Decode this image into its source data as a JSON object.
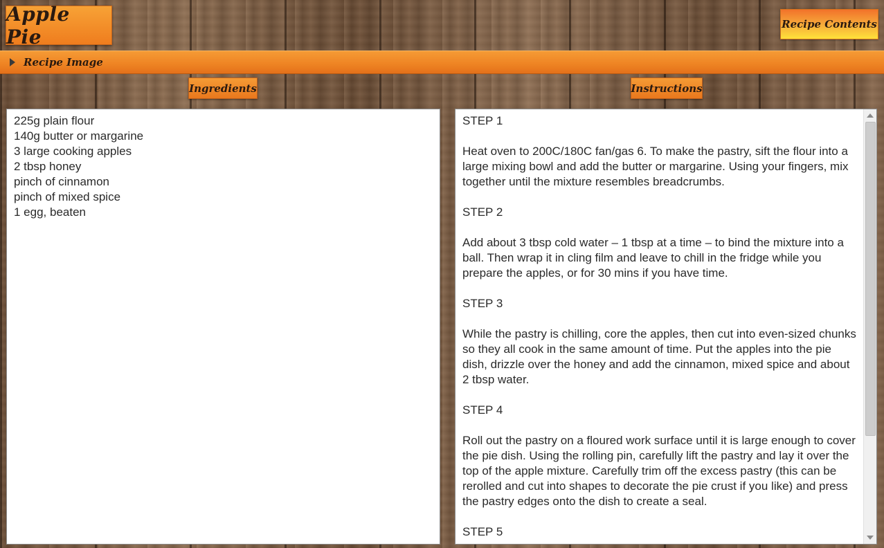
{
  "header": {
    "title": "Apple Pie",
    "contents_button_label": "Recipe Contents"
  },
  "image_section": {
    "label": "Recipe Image",
    "toggle_icon": "triangle-right-icon"
  },
  "ingredients": {
    "heading": "Ingredients",
    "items": [
      "225g plain flour",
      "140g butter or margarine",
      "3 large cooking apples",
      "2 tbsp honey",
      "pinch of cinnamon",
      "pinch of mixed spice",
      "1 egg, beaten"
    ]
  },
  "instructions": {
    "heading": "Instructions",
    "blocks": [
      "STEP 1",
      "Heat oven to 200C/180C fan/gas 6. To make the pastry, sift the flour into a large mixing bowl and add the butter or margarine. Using your fingers, mix together until the mixture resembles breadcrumbs.",
      "STEP 2",
      "Add about 3 tbsp cold water – 1 tbsp at a time – to bind the mixture into a ball. Then wrap it in cling film and leave to chill in the fridge while you prepare the apples, or for 30 mins if you have time.",
      "STEP 3",
      "While the pastry is chilling, core the apples, then cut into even-sized chunks so they all cook in the same amount of time. Put the apples into the pie dish, drizzle over the honey and add the cinnamon, mixed spice and about 2 tbsp water.",
      "STEP 4",
      "Roll out the pastry on a floured work surface until it is large enough to cover the pie dish. Using the rolling pin, carefully lift the pastry and lay it over the top of the apple mixture. Carefully trim off the excess pastry (this can be rerolled and cut into shapes to decorate the pie crust if you like) and press the pastry edges onto the dish to create a seal.",
      "STEP 5"
    ]
  },
  "colors": {
    "accent_orange": "#ef8524",
    "button_yellow": "#ffe23a",
    "text_dark": "#2a1a10"
  }
}
